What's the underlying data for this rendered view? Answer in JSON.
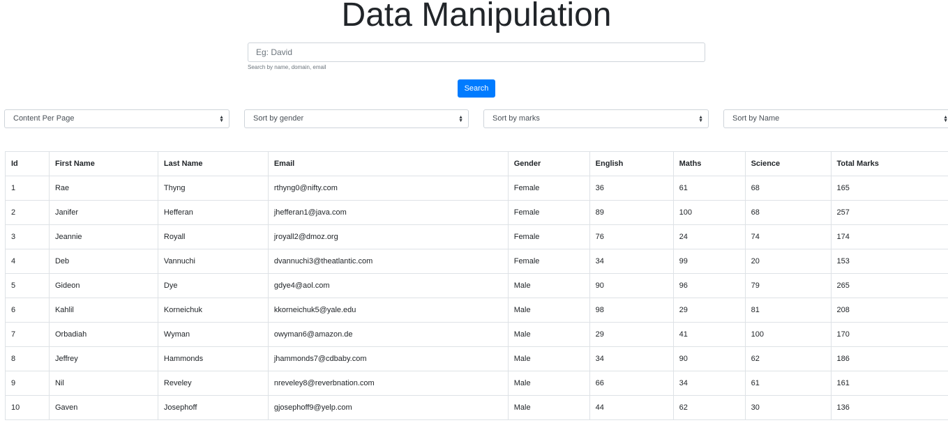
{
  "header": {
    "title": "Data Manipulation"
  },
  "search": {
    "placeholder": "Eg: David",
    "value": "",
    "help_text": "Search by name, domain, email",
    "button_label": "Search"
  },
  "selects": {
    "content_per_page": "Content Per Page",
    "gender": "Sort by gender",
    "marks": "Sort by marks",
    "name": "Sort by Name"
  },
  "table": {
    "columns": [
      "Id",
      "First Name",
      "Last Name",
      "Email",
      "Gender",
      "English",
      "Maths",
      "Science",
      "Total Marks"
    ],
    "rows": [
      [
        "1",
        "Rae",
        "Thyng",
        "rthyng0@nifty.com",
        "Female",
        "36",
        "61",
        "68",
        "165"
      ],
      [
        "2",
        "Janifer",
        "Hefferan",
        "jhefferan1@java.com",
        "Female",
        "89",
        "100",
        "68",
        "257"
      ],
      [
        "3",
        "Jeannie",
        "Royall",
        "jroyall2@dmoz.org",
        "Female",
        "76",
        "24",
        "74",
        "174"
      ],
      [
        "4",
        "Deb",
        "Vannuchi",
        "dvannuchi3@theatlantic.com",
        "Female",
        "34",
        "99",
        "20",
        "153"
      ],
      [
        "5",
        "Gideon",
        "Dye",
        "gdye4@aol.com",
        "Male",
        "90",
        "96",
        "79",
        "265"
      ],
      [
        "6",
        "Kahlil",
        "Korneichuk",
        "kkorneichuk5@yale.edu",
        "Male",
        "98",
        "29",
        "81",
        "208"
      ],
      [
        "7",
        "Orbadiah",
        "Wyman",
        "owyman6@amazon.de",
        "Male",
        "29",
        "41",
        "100",
        "170"
      ],
      [
        "8",
        "Jeffrey",
        "Hammonds",
        "jhammonds7@cdbaby.com",
        "Male",
        "34",
        "90",
        "62",
        "186"
      ],
      [
        "9",
        "Nil",
        "Reveley",
        "nreveley8@reverbnation.com",
        "Male",
        "66",
        "34",
        "61",
        "161"
      ],
      [
        "10",
        "Gaven",
        "Josephoff",
        "gjosephoff9@yelp.com",
        "Male",
        "44",
        "62",
        "30",
        "136"
      ]
    ]
  },
  "icons": {
    "select_arrow": "updown-caret-icon"
  },
  "colors": {
    "primary": "#007bff",
    "border": "#dee2e6",
    "text": "#212529"
  }
}
